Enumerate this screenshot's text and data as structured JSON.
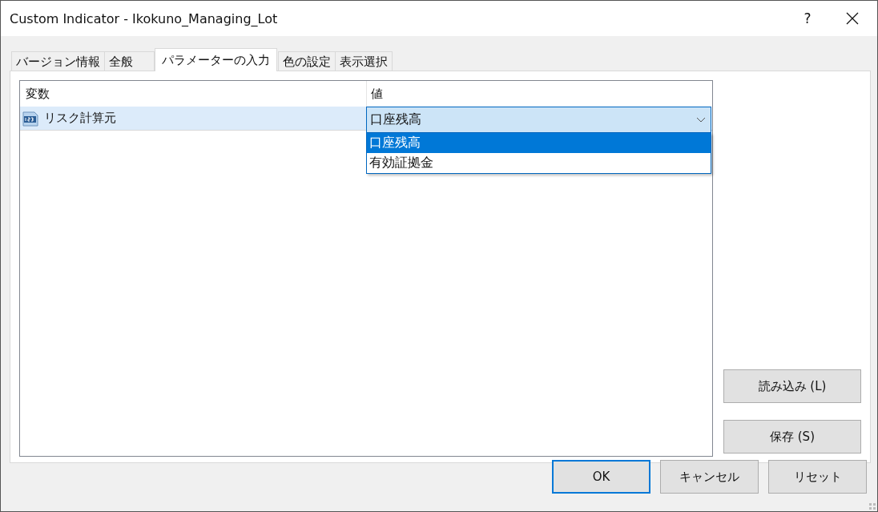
{
  "window": {
    "title": "Custom Indicator - Ikokuno_Managing_Lot",
    "help": "?"
  },
  "tabs": [
    {
      "label": "バージョン情報",
      "selected": false
    },
    {
      "label": "全般",
      "selected": false
    },
    {
      "label": "パラメーターの入力",
      "selected": true
    },
    {
      "label": "色の設定",
      "selected": false
    },
    {
      "label": "表示選択",
      "selected": false
    }
  ],
  "table": {
    "columns": [
      "変数",
      "値"
    ],
    "rows": [
      {
        "name": "リスク計算元",
        "value": "口座残高",
        "selected": true,
        "expanded": true,
        "options": [
          {
            "label": "口座残高",
            "selected": true
          },
          {
            "label": "有効証拠金",
            "selected": false
          }
        ]
      }
    ]
  },
  "side_buttons": [
    "読み込み (L)",
    "保存 (S)"
  ],
  "buttons": [
    {
      "label": "OK",
      "default": true
    },
    {
      "label": "キャンセル",
      "default": false
    },
    {
      "label": "リセット",
      "default": false
    }
  ]
}
